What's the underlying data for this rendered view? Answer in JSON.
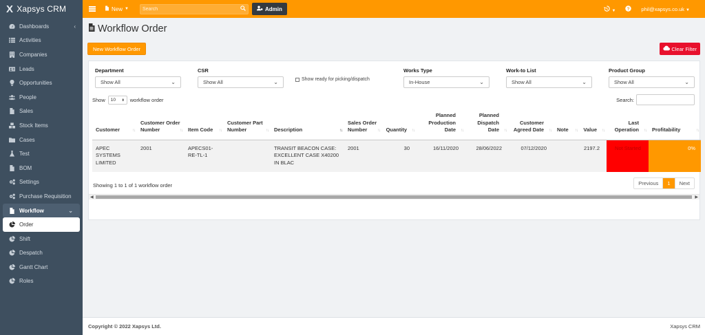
{
  "brand": {
    "logo": "X",
    "name": "Xapsys CRM"
  },
  "sidebar": {
    "items": [
      {
        "label": "Dashboards",
        "icon": "dashboard-icon",
        "chevron": "‹"
      },
      {
        "label": "Activities",
        "icon": "list-icon"
      },
      {
        "label": "Companies",
        "icon": "building-icon"
      },
      {
        "label": "Leads",
        "icon": "address-card-icon"
      },
      {
        "label": "Opportunities",
        "icon": "lightbulb-icon"
      },
      {
        "label": "People",
        "icon": "users-icon"
      },
      {
        "label": "Sales",
        "icon": "file-icon"
      },
      {
        "label": "Stock Items",
        "icon": "boxes-icon"
      },
      {
        "label": "Cases",
        "icon": "folder-icon"
      },
      {
        "label": "Test",
        "icon": "flask-icon"
      },
      {
        "label": "BOM",
        "icon": "file-icon"
      },
      {
        "label": "Settings",
        "icon": "gears-icon"
      },
      {
        "label": "Purchase Requisition",
        "icon": "gears-icon"
      },
      {
        "label": "Workflow",
        "icon": "file-icon",
        "chevron": "⌄"
      },
      {
        "label": "Order",
        "icon": "pie-chart-icon"
      },
      {
        "label": "Shift",
        "icon": "pie-chart-icon"
      },
      {
        "label": "Despatch",
        "icon": "pie-chart-icon"
      },
      {
        "label": "Gantt Chart",
        "icon": "pie-chart-icon"
      },
      {
        "label": "Roles",
        "icon": "pie-chart-icon"
      }
    ]
  },
  "topbar": {
    "new_label": "New",
    "search_placeholder": "Search",
    "admin_label": "Admin",
    "user_email": "phil@xapsys.co.uk"
  },
  "page": {
    "title": "Workflow Order",
    "new_button": "New Workflow Order",
    "clear_filter": "Clear Filter"
  },
  "filters": {
    "department": {
      "label": "Department",
      "value": "Show All"
    },
    "csr": {
      "label": "CSR",
      "value": "Show All"
    },
    "ready_checkbox": "Show ready for picking/dispatch",
    "works_type": {
      "label": "Works Type",
      "value": "In-House"
    },
    "work_to_list": {
      "label": "Work-to List",
      "value": "Show All"
    },
    "product_group": {
      "label": "Product Group",
      "value": "Show All"
    }
  },
  "table_controls": {
    "show_label": "Show",
    "page_length": "10",
    "entries_label": "workflow order",
    "search_label": "Search:"
  },
  "table": {
    "headers": [
      "Customer",
      "Customer Order Number",
      "Item Code",
      "Customer Part Number",
      "Description",
      "Sales Order Number",
      "Quantity",
      "Planned Production Date",
      "Planned Dispatch Date",
      "Customer Agreed Date",
      "Note",
      "Value",
      "Last Operation",
      "Profitability"
    ],
    "rows": [
      [
        "APEC SYSTEMS LIMITED",
        "2001",
        "APECS01-RE-TL-1",
        "",
        "TRANSIT BEACON CASE: EXCELLENT CASE X40200 IN BLAC",
        "2001",
        "30",
        "16/11/2020",
        "28/06/2022",
        "07/12/2020",
        "",
        "2197.2",
        "Not Started",
        "0%"
      ]
    ]
  },
  "pagination": {
    "info": "Showing 1 to 1 of 1 workflow order",
    "previous": "Previous",
    "current": "1",
    "next": "Next"
  },
  "footer": {
    "copyright": "Copyright © 2022 Xapsys Ltd.",
    "brand": "Xapsys CRM"
  },
  "colors": {
    "accent": "#ff9800",
    "sidebar": "#3e4f5f",
    "danger": "#e8112d",
    "status_red": "#ff0000"
  }
}
